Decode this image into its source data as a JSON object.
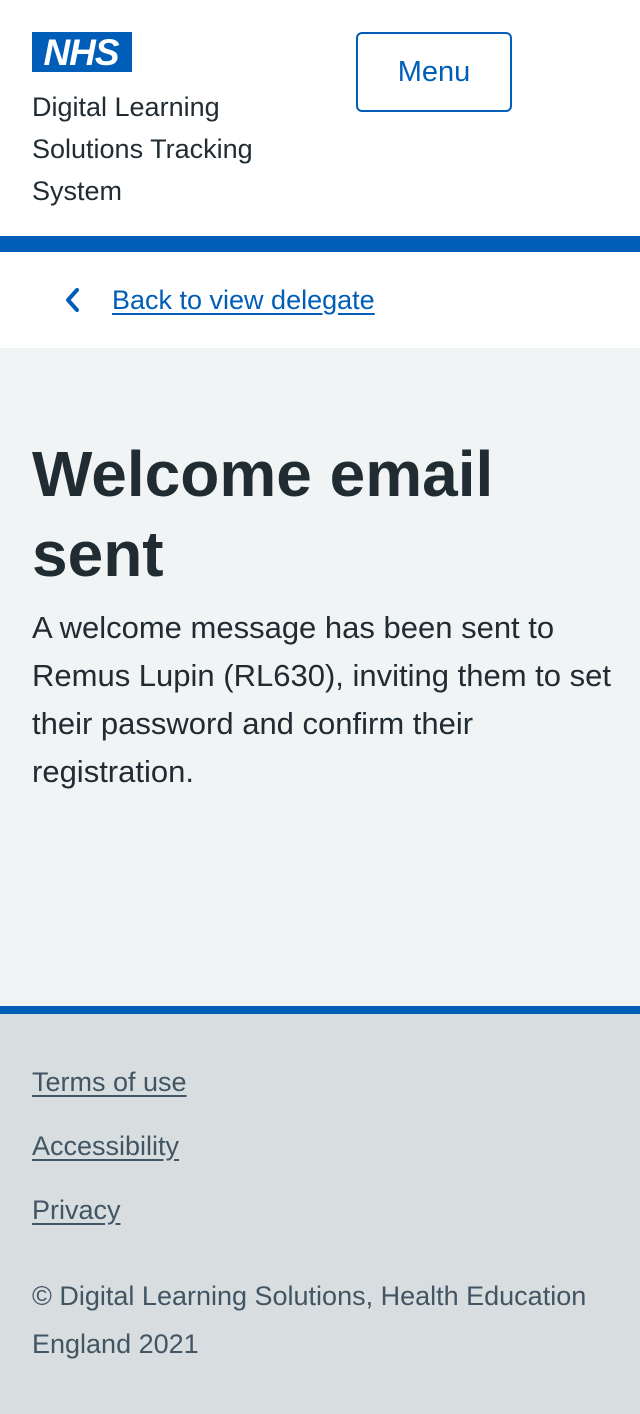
{
  "header": {
    "logo_text": "NHS",
    "service_name": "Digital Learning Solutions Tracking System",
    "menu_label": "Menu"
  },
  "back_link": {
    "label": "Back to view delegate",
    "icon": "chevron-left-icon"
  },
  "main": {
    "title": "Welcome email sent",
    "body": "A welcome message has been sent to Remus Lupin (RL630), inviting them to set their password and confirm their registration."
  },
  "footer": {
    "links": [
      {
        "label": "Terms of use"
      },
      {
        "label": "Accessibility"
      },
      {
        "label": "Privacy"
      }
    ],
    "copyright": "© Digital Learning Solutions, Health Education England 2021"
  },
  "colors": {
    "nhs_blue": "#005eb8",
    "text": "#212b32",
    "secondary_text": "#425563",
    "page_background": "#f0f4f5",
    "footer_background": "#d8dde0",
    "white": "#ffffff"
  }
}
